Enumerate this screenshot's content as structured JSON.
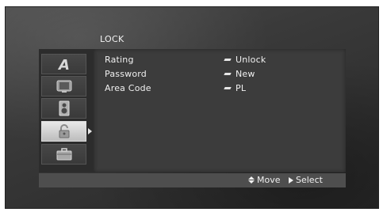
{
  "menu": {
    "title": "LOCK",
    "items": [
      {
        "label": "Rating",
        "value": "Unlock"
      },
      {
        "label": "Password",
        "value": "New"
      },
      {
        "label": "Area Code",
        "value": "PL"
      }
    ]
  },
  "sidebar": {
    "tabs": [
      {
        "icon": "language-icon",
        "selected": false
      },
      {
        "icon": "display-icon",
        "selected": false
      },
      {
        "icon": "audio-icon",
        "selected": false
      },
      {
        "icon": "lock-icon",
        "selected": true
      },
      {
        "icon": "others-icon",
        "selected": false
      }
    ]
  },
  "hints": {
    "move": "Move",
    "select": "Select"
  }
}
